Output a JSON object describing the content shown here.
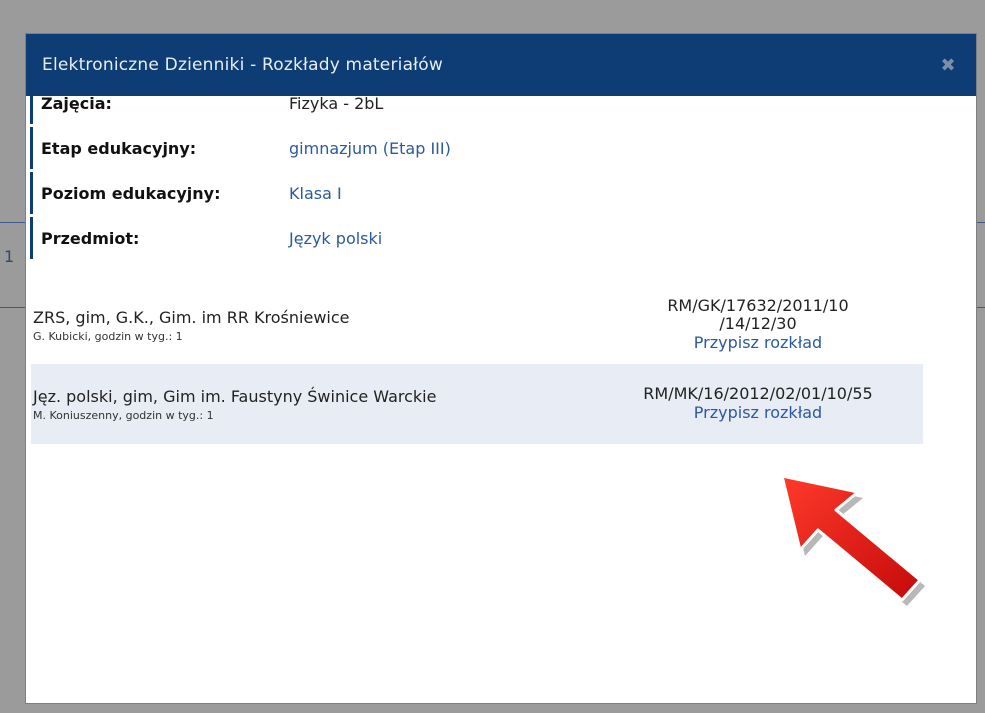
{
  "background": {
    "cell_number": "1"
  },
  "dialog": {
    "title": "Elektroniczne Dzienniki - Rozkłady materiałów",
    "close_icon": "close-icon"
  },
  "info": [
    {
      "label": "Zajęcia:",
      "value": "Fizyka - 2bL",
      "is_link": false
    },
    {
      "label": "Etap edukacyjny:",
      "value": "gimnazjum (Etap III)",
      "is_link": true
    },
    {
      "label": "Poziom edukacyjny:",
      "value": "Klasa I",
      "is_link": true
    },
    {
      "label": "Przedmiot:",
      "value": "Język polski",
      "is_link": true
    }
  ],
  "schedules": [
    {
      "title": "ZRS, gim, G.K., Gim. im RR Krośniewice",
      "subtitle": "G. Kubicki, godzin w tyg.: 1",
      "code_line1": "RM/GK/17632/2011/10",
      "code_line2": "/14/12/30",
      "action": "Przypisz rozkład"
    },
    {
      "title": "Jęz. polski, gim, Gim im. Faustyny Świnice Warckie",
      "subtitle": "M. Koniuszenny, godzin w tyg.: 1",
      "code_line1": "RM/MK/16/2012/02/01/10/55",
      "action": "Przypisz rozkład"
    }
  ],
  "colors": {
    "header_bg": "#0d3d74",
    "link": "#2a5aa0",
    "highlight_row": "#e8ecf4",
    "arrow": "#e01212"
  }
}
